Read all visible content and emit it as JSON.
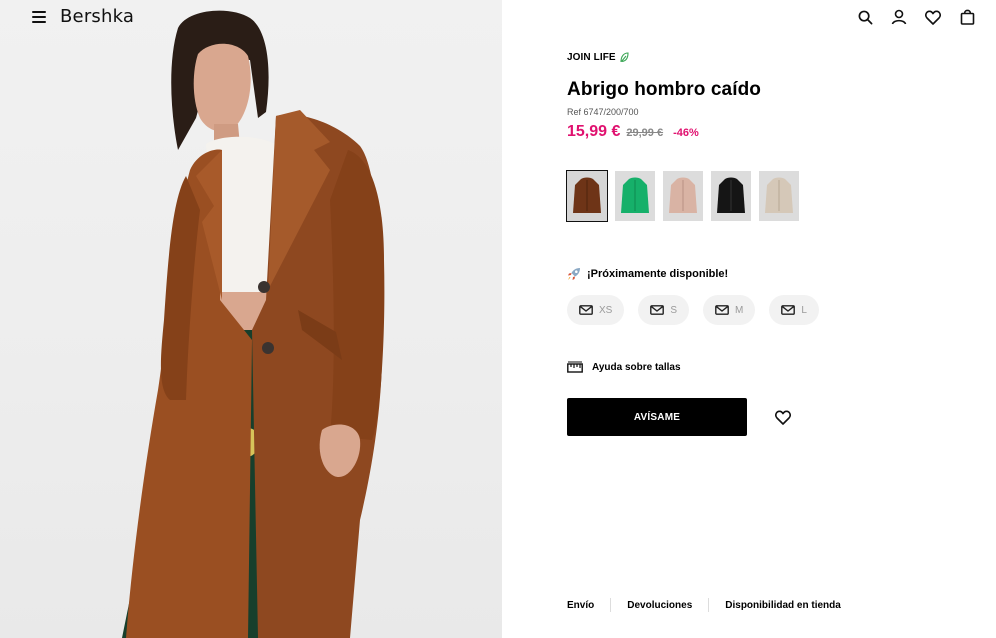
{
  "brand": {
    "name": "Bershka"
  },
  "header": {
    "icons": [
      "search-icon",
      "user-icon",
      "heart-icon",
      "bag-icon"
    ]
  },
  "product": {
    "badge": "JOIN LIFE",
    "title": "Abrigo hombro caído",
    "ref": "Ref 6747/200/700",
    "price": "15,99 €",
    "old_price": "29,99 €",
    "discount": "-46%",
    "colors": [
      {
        "name": "brown",
        "hex": "#6e3417"
      },
      {
        "name": "green",
        "hex": "#16b06a"
      },
      {
        "name": "pink",
        "hex": "#d9b3a4"
      },
      {
        "name": "black",
        "hex": "#151515"
      },
      {
        "name": "beige",
        "hex": "#d5c8b8"
      }
    ],
    "availability": "¡Próximamente disponible!",
    "sizes": [
      "XS",
      "S",
      "M",
      "L"
    ],
    "size_help": "Ayuda sobre tallas",
    "cta": "AVÍSAME"
  },
  "footer_links": [
    "Envío",
    "Devoluciones",
    "Disponibilidad en tienda"
  ],
  "colors": {
    "accent": "#e0116f",
    "button": "#000000"
  }
}
